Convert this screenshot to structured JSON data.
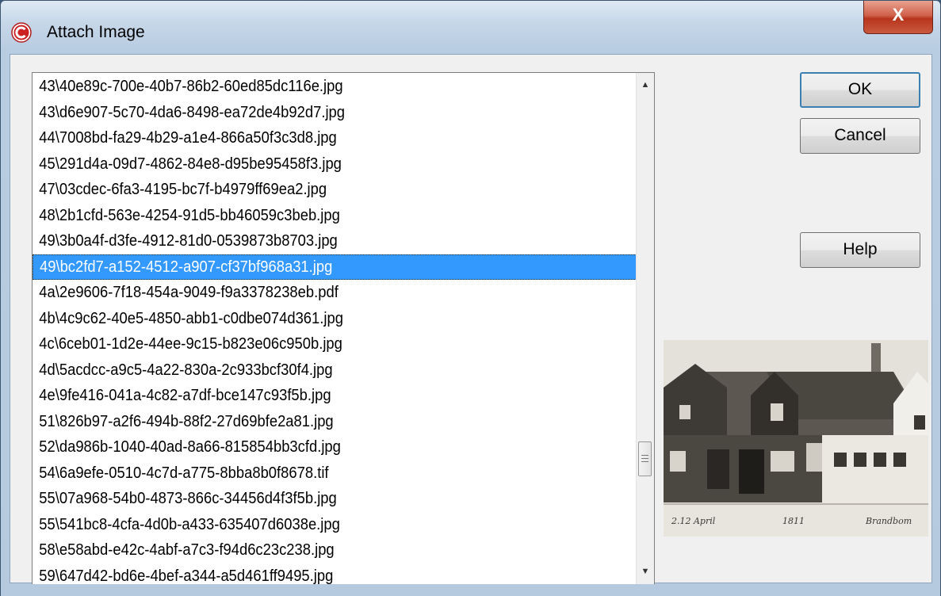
{
  "window": {
    "title": "Attach Image",
    "close_label": "X",
    "icon": "app-c-logo-icon"
  },
  "file_list": {
    "selected_index": 7,
    "items": [
      "43\\40e89c-700e-40b7-86b2-60ed85dc116e.jpg",
      "43\\d6e907-5c70-4da6-8498-ea72de4b92d7.jpg",
      "44\\7008bd-fa29-4b29-a1e4-866a50f3c3d8.jpg",
      "45\\291d4a-09d7-4862-84e8-d95be95458f3.jpg",
      "47\\03cdec-6fa3-4195-bc7f-b4979ff69ea2.jpg",
      "48\\2b1cfd-563e-4254-91d5-bb46059c3beb.jpg",
      "49\\3b0a4f-d3fe-4912-81d0-0539873b8703.jpg",
      "49\\bc2fd7-a152-4512-a907-cf37bf968a31.jpg",
      "4a\\2e9606-7f18-454a-9049-f9a3378238eb.pdf",
      "4b\\4c9c62-40e5-4850-abb1-c0dbe074d361.jpg",
      "4c\\6ceb01-1d2e-44ee-9c15-b823e06c950b.jpg",
      "4d\\5acdcc-a9c5-4a22-830a-2c933bcf30f4.jpg",
      "4e\\9fe416-041a-4c82-a7df-bce147c93f5b.jpg",
      "51\\826b97-a2f6-494b-88f2-27d69bfe2a81.jpg",
      "52\\da986b-1040-40ad-8a66-815854bb3cfd.jpg",
      "54\\6a9efe-0510-4c7d-a775-8bba8b0f8678.tif",
      "55\\07a968-54b0-4873-866c-34456d4f3f5b.jpg",
      "55\\541bc8-4cfa-4d0b-a433-635407d6038e.jpg",
      "58\\e58abd-e42c-4abf-a7c3-f94d6c23c238.jpg",
      "59\\647d42-bd6e-4bef-a344-a5d461ff9495.jpg"
    ]
  },
  "buttons": {
    "ok": "OK",
    "cancel": "Cancel",
    "help": "Help"
  },
  "preview": {
    "caption_left": "2.12 April",
    "caption_mid": "1811",
    "caption_right": "Brandbom"
  }
}
